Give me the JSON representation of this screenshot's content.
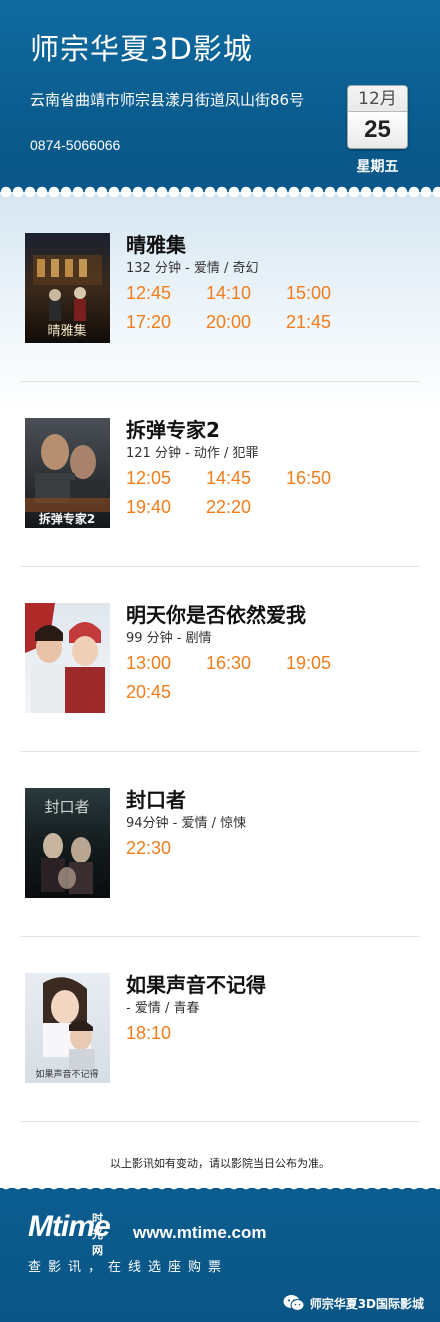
{
  "header": {
    "cinema_name": "师宗华夏3D影城",
    "address": "云南省曲靖市师宗县漾月街道凤山街86号",
    "phone": "0874-5066066",
    "date": {
      "month": "12月",
      "day": "25",
      "weekday": "星期五"
    }
  },
  "movies": [
    {
      "title": "晴雅集",
      "meta": "132 分钟 - 爱情 / 奇幻",
      "times": [
        "12:45",
        "14:10",
        "15:00",
        "17:20",
        "20:00",
        "21:45"
      ],
      "poster_text": "晴雅集"
    },
    {
      "title": "拆弹专家2",
      "meta": "121 分钟 - 动作 / 犯罪",
      "times": [
        "12:05",
        "14:45",
        "16:50",
        "19:40",
        "22:20"
      ],
      "poster_text": "拆弹专家2"
    },
    {
      "title": "明天你是否依然爱我",
      "meta": "99 分钟 - 剧情",
      "times": [
        "13:00",
        "16:30",
        "19:05",
        "20:45"
      ],
      "poster_text": ""
    },
    {
      "title": "封口者",
      "meta": "94分钟 - 爱情 / 惊悚",
      "times": [
        "22:30"
      ],
      "poster_text": "封口者"
    },
    {
      "title": "如果声音不记得",
      "meta": "- 爱情 / 青春",
      "times": [
        "18:10"
      ],
      "poster_text": "如果声音不记得"
    }
  ],
  "notice": "以上影讯如有变动，请以影院当日公布为准。",
  "footer": {
    "logo_mark": "Mtime",
    "logo_cn": "时光网",
    "url": "www.mtime.com",
    "slogan": "查影讯，在线选座购票",
    "wechat_account": "师宗华夏3D国际影城"
  },
  "colors": {
    "header_blue": "#0b5c8e",
    "showtime_orange": "#f07c1a"
  }
}
